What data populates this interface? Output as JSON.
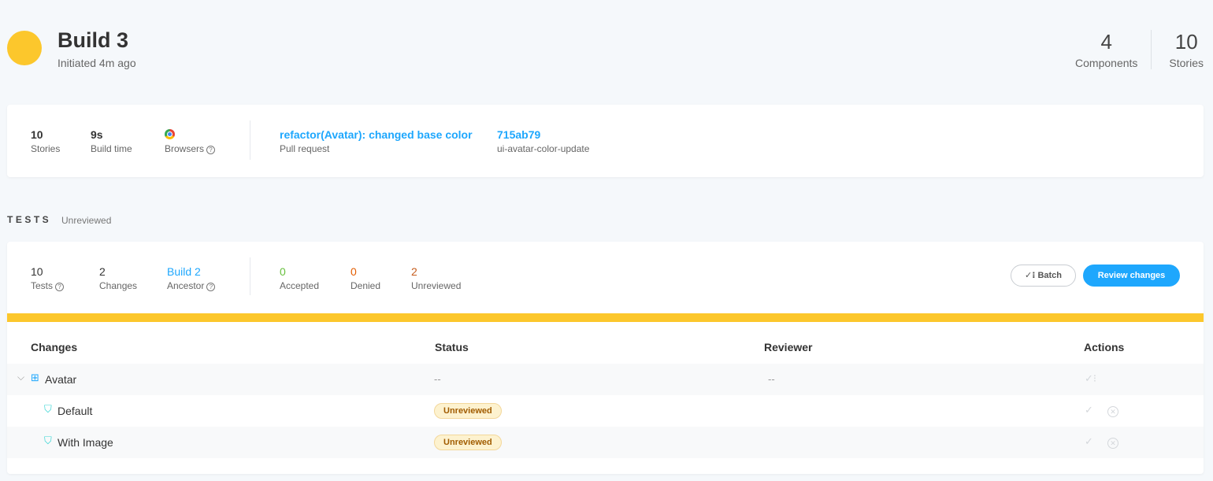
{
  "header": {
    "title": "Build 3",
    "subtitle": "Initiated 4m ago",
    "status_color": "#fcc72c",
    "metrics": [
      {
        "value": "4",
        "label": "Components"
      },
      {
        "value": "10",
        "label": "Stories"
      }
    ]
  },
  "info": {
    "stories_value": "10",
    "stories_label": "Stories",
    "build_time_value": "9s",
    "build_time_label": "Build time",
    "browsers_label": "Browsers",
    "browser_icon": "chrome-icon",
    "pr_title": "refactor(Avatar): changed base color",
    "pr_label": "Pull request",
    "commit_hash": "715ab79",
    "branch": "ui-avatar-color-update"
  },
  "tests": {
    "heading": "TESTS",
    "heading_status": "Unreviewed",
    "tests_value": "10",
    "tests_label": "Tests",
    "changes_value": "2",
    "changes_label": "Changes",
    "ancestor_value": "Build 2",
    "ancestor_label": "Ancestor",
    "accepted_value": "0",
    "accepted_label": "Accepted",
    "denied_value": "0",
    "denied_label": "Denied",
    "unreviewed_value": "2",
    "unreviewed_label": "Unreviewed",
    "batch_label": "Batch",
    "review_label": "Review changes",
    "accent_color": "#1ea7fd"
  },
  "table": {
    "columns": [
      "Changes",
      "Status",
      "Reviewer",
      "Actions"
    ],
    "component": {
      "name": "Avatar",
      "status": "--",
      "reviewer": "--"
    },
    "stories": [
      {
        "name": "Default",
        "status": "Unreviewed"
      },
      {
        "name": "With Image",
        "status": "Unreviewed"
      }
    ]
  }
}
